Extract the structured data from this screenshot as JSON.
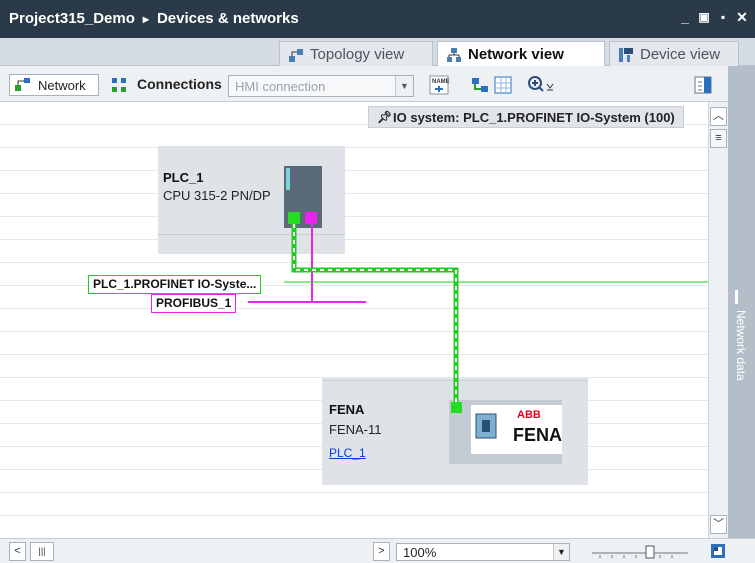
{
  "window": {
    "breadcrumb": [
      "Project315_Demo",
      "Devices & networks"
    ],
    "separator": "▸",
    "controls": {
      "minimize": "_",
      "restore": "▣",
      "tile": "▪",
      "close": "✕"
    }
  },
  "tabs": [
    {
      "label": "Topology view",
      "icon": "topology-icon",
      "active": false
    },
    {
      "label": "Network view",
      "icon": "network-icon",
      "active": true
    },
    {
      "label": "Device view",
      "icon": "device-icon",
      "active": false
    }
  ],
  "toolbar": {
    "network_label": "Network",
    "connections_label": "Connections",
    "hmi_connection": "HMI connection"
  },
  "canvas": {
    "io_system": "IO system: PLC_1.PROFINET IO-System (100)",
    "plc": {
      "name": "PLC_1",
      "type": "CPU 315-2 PN/DP"
    },
    "profinet_label": "PLC_1.PROFINET IO-Syste...",
    "profibus_label": "PROFIBUS_1",
    "fena": {
      "name": "FENA",
      "type": "FENA-11",
      "link": "PLC_1",
      "logo_text": "FENA",
      "abb": "ABB"
    }
  },
  "side_panel": {
    "label": "Network data"
  },
  "bottom": {
    "zoom": "100%"
  },
  "colors": {
    "titlebar": "#2a3a48",
    "profinet": "#2ecc40",
    "profibus": "#e040e0",
    "device_bg": "#dfe3e7",
    "link": "#0a3be0"
  }
}
